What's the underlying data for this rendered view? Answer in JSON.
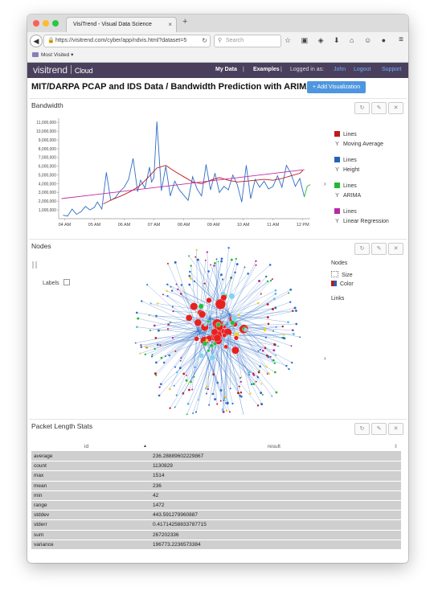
{
  "browser": {
    "tab_title": "VisiTrend - Visual Data Science",
    "tab_close": "×",
    "new_tab": "+",
    "url": "https://visitrend.com/cyber/app/ndvis.html?dataset=5",
    "search_placeholder": "Search",
    "bookmark_label": "Most Visited",
    "toolbar_icons": "☆ ▣ ◈ ⬇ ⌂ ☺ ●",
    "menu_glyph": "≡"
  },
  "app_header": {
    "logo_visi": "visitrend",
    "logo_cloud": "Cloud",
    "my_data": "My Data",
    "separator": "|",
    "examples": "Examples",
    "logged_in_as": "Logged in as:",
    "user": "John",
    "logout": "Logout",
    "support": "Support"
  },
  "page": {
    "title": "MIT/DARPA PCAP and IDS Data / Bandwidth Prediction with ARIMA",
    "add_button": "+ Add Visualization"
  },
  "panel_buttons": {
    "refresh": "↻",
    "edit": "✎",
    "close": "✕"
  },
  "bandwidth_panel": {
    "title": "Bandwidth",
    "legend": [
      {
        "kind": "swatch",
        "label": "Lines",
        "color": "#c0181c"
      },
      {
        "kind": "y",
        "label": "Moving Average"
      },
      {
        "kind": "swatch",
        "label": "Lines",
        "color": "#2563b8"
      },
      {
        "kind": "y",
        "label": "Height"
      },
      {
        "kind": "swatch",
        "label": "Lines",
        "color": "#22b832"
      },
      {
        "kind": "y",
        "label": "ARIMA"
      },
      {
        "kind": "swatch",
        "label": "Lines",
        "color": "#b52aa2"
      },
      {
        "kind": "y",
        "label": "Linear Regression"
      }
    ],
    "expand_glyph": "›"
  },
  "chart_data": {
    "type": "line",
    "title": "",
    "xlabel": "",
    "ylabel": "",
    "x_ticks": [
      "04 AM",
      "05 AM",
      "06 AM",
      "07 AM",
      "08 AM",
      "09 AM",
      "10 AM",
      "11 AM",
      "12 PM"
    ],
    "y_ticks": [
      "1,000,000",
      "2,000,000",
      "3,000,000",
      "4,000,000",
      "5,000,000",
      "6,000,000",
      "7,000,000",
      "8,000,000",
      "9,000,000",
      "10,000,000",
      "11,000,000"
    ],
    "xlim": [
      3.8,
      12.25
    ],
    "ylim": [
      0,
      11500000
    ],
    "series": [
      {
        "name": "Height",
        "color": "#2f6dc4",
        "x": [
          3.95,
          4.1,
          4.25,
          4.4,
          4.55,
          4.7,
          4.85,
          5.0,
          5.1,
          5.25,
          5.4,
          5.55,
          5.7,
          5.85,
          6.0,
          6.15,
          6.3,
          6.45,
          6.55,
          6.7,
          6.85,
          6.92,
          7.0,
          7.1,
          7.25,
          7.4,
          7.55,
          7.7,
          7.85,
          8.0,
          8.15,
          8.3,
          8.45,
          8.6,
          8.75,
          8.9,
          9.05,
          9.2,
          9.35,
          9.5,
          9.65,
          9.8,
          9.95,
          10.1,
          10.25,
          10.4,
          10.55,
          10.7,
          10.85,
          11.0,
          11.15,
          11.3,
          11.45,
          11.6,
          11.75,
          11.9,
          12.05
        ],
        "values": [
          400000.0,
          300000.0,
          1100000.0,
          500000.0,
          800000.0,
          1400000.0,
          1000000.0,
          1300000.0,
          1900000.0,
          1100000.0,
          5300000.0,
          2100000.0,
          2400000.0,
          3100000.0,
          3600000.0,
          4500000.0,
          6900000.0,
          3100000.0,
          4400000.0,
          3500000.0,
          5900000.0,
          4200000.0,
          4700000.0,
          11100000.0,
          3200000.0,
          6000000.0,
          2600000.0,
          4300000.0,
          3300000.0,
          2700000.0,
          2100000.0,
          4800000.0,
          3400000.0,
          2600000.0,
          6200000.0,
          3300000.0,
          5200000.0,
          3000000.0,
          3700000.0,
          3300000.0,
          5000000.0,
          3900000.0,
          1900000.0,
          6100000.0,
          2300000.0,
          4500000.0,
          3600000.0,
          4300000.0,
          3400000.0,
          3700000.0,
          4900000.0,
          3600000.0,
          6100000.0,
          5200000.0,
          3700000.0,
          4600000.0,
          2500000.0
        ]
      },
      {
        "name": "Moving Average",
        "color": "#c0181c",
        "x": [
          5.3,
          5.6,
          5.9,
          6.2,
          6.5,
          6.8,
          7.1,
          7.4,
          7.7,
          8.0,
          8.3,
          8.6,
          8.9,
          9.2,
          9.5,
          9.8,
          10.1,
          10.4,
          10.7,
          11.0,
          11.3,
          11.6,
          11.9,
          12.0
        ],
        "values": [
          1700000.0,
          2200000.0,
          2600000.0,
          3100000.0,
          3700000.0,
          4700000.0,
          5800000.0,
          6100000.0,
          5400000.0,
          4800000.0,
          4200000.0,
          4000000.0,
          4400000.0,
          4700000.0,
          4400000.0,
          4200000.0,
          4300000.0,
          4400000.0,
          4500000.0,
          4400000.0,
          4600000.0,
          4900000.0,
          5200000.0,
          5500000.0
        ]
      },
      {
        "name": "Linear Regression",
        "color": "#c42aa6",
        "x": [
          3.9,
          12.05
        ],
        "values": [
          2300000.0,
          5600000.0
        ]
      },
      {
        "name": "ARIMA",
        "color": "#22b832",
        "x": [
          12.05,
          12.15,
          12.25
        ],
        "values": [
          2500000.0,
          3700000.0,
          3900000.0
        ]
      }
    ]
  },
  "nodes_panel": {
    "title": "Nodes",
    "labels_text": "Labels",
    "legend_nodes": "Nodes",
    "legend_size": "Size",
    "legend_color": "Color",
    "legend_links": "Links",
    "expand_glyph": "›"
  },
  "stats_panel": {
    "title": "Packet Length Stats",
    "col_id": "id",
    "col_result": "result",
    "sort_asc_glyph": "▲",
    "sort_glyph": "⇕",
    "rows": [
      {
        "id": "average",
        "result": "236.28889602229867"
      },
      {
        "id": "count",
        "result": "1130829"
      },
      {
        "id": "max",
        "result": "1514"
      },
      {
        "id": "mean",
        "result": "236"
      },
      {
        "id": "min",
        "result": "42"
      },
      {
        "id": "range",
        "result": "1472"
      },
      {
        "id": "stddev",
        "result": "443.591279960887"
      },
      {
        "id": "stderr",
        "result": "0.41714258833787715"
      },
      {
        "id": "sum",
        "result": "267202336"
      },
      {
        "id": "variance",
        "result": "196773.2236573384"
      }
    ]
  }
}
